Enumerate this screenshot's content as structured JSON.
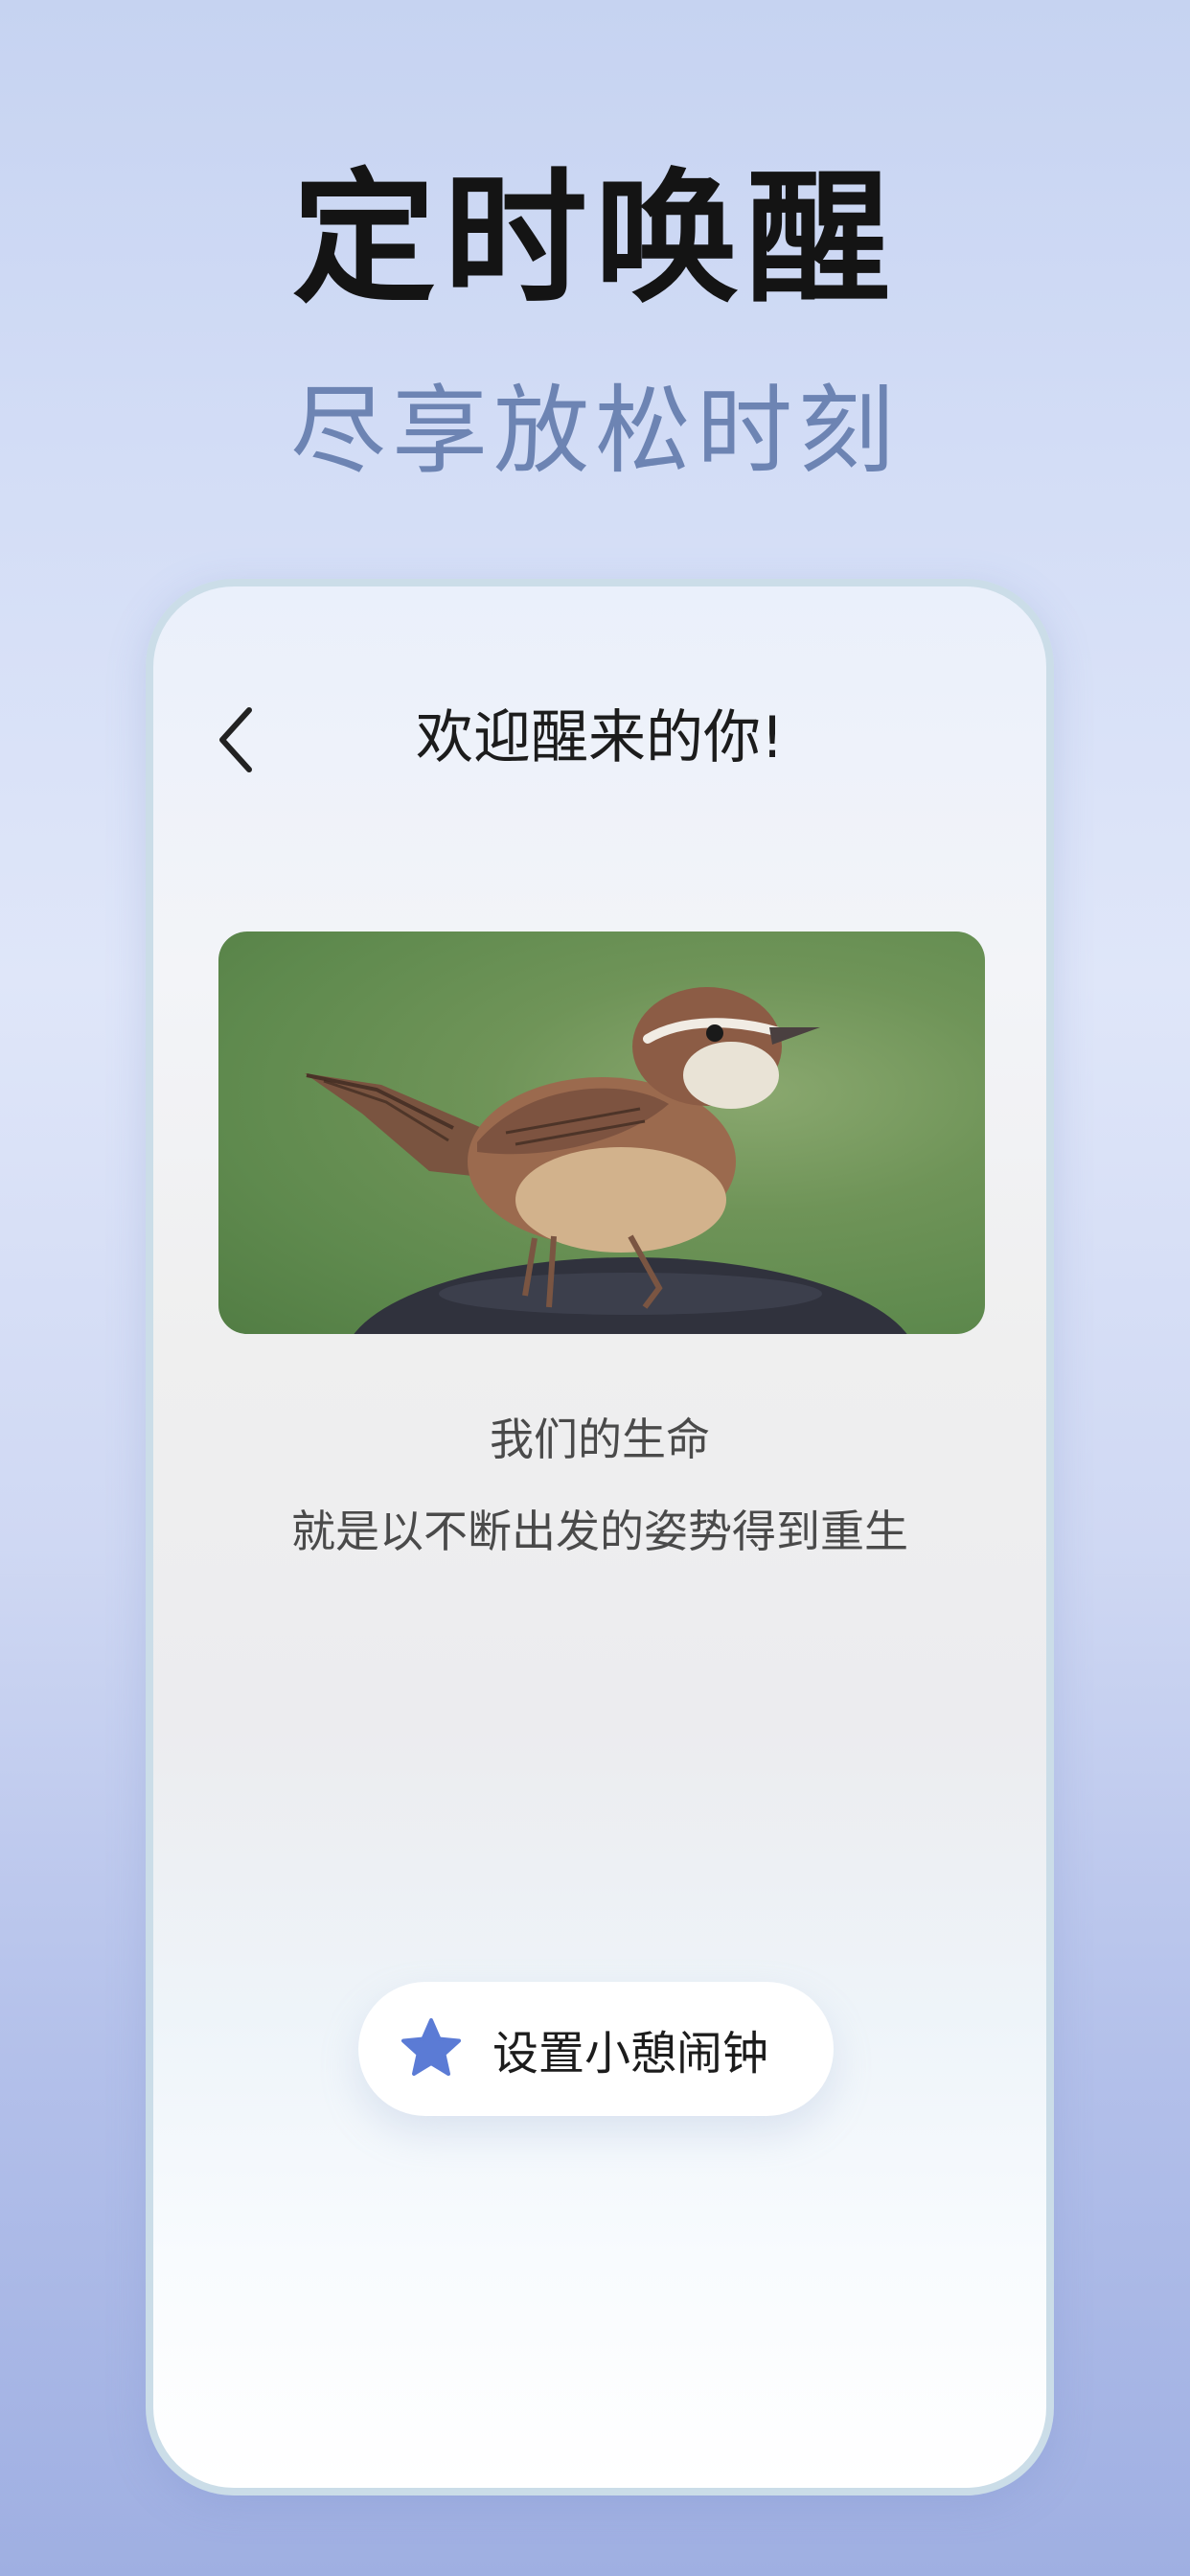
{
  "headline": "定时唤醒",
  "subline": "尽享放松时刻",
  "screen": {
    "title": "欢迎醒来的你!",
    "back_icon": "chevron-left-icon",
    "photo": "wren-bird-photo",
    "quote_line1": "我们的生命",
    "quote_line2": "就是以不断出发的姿势得到重生",
    "cta_label": "设置小憩闹钟",
    "cta_icon": "star-icon"
  },
  "colors": {
    "accent_star": "#5b7bd5",
    "subline": "#6d84b3"
  }
}
